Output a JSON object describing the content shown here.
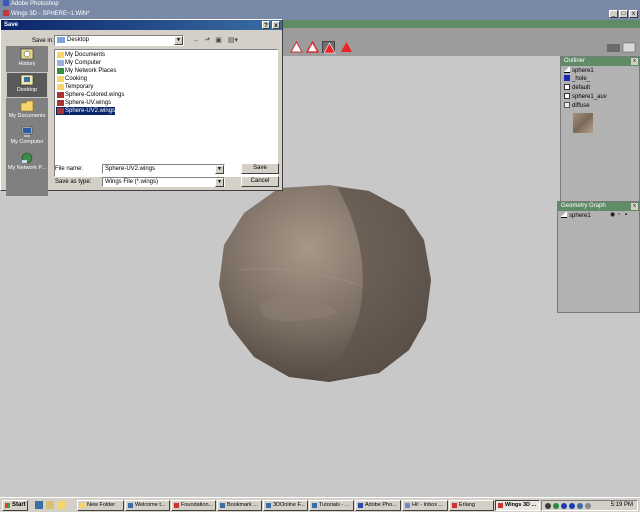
{
  "photoshop_title": "Adobe Photoshop",
  "wings_title": "Wings 3D - SPHERE~1.WIN*",
  "window_buttons": [
    "_",
    "□",
    "x"
  ],
  "dialog": {
    "title": "Save",
    "help": "?",
    "close": "x",
    "save_in_label": "Save in:",
    "save_in_value": "Desktop",
    "places": [
      {
        "label": "History",
        "icon": "history-icon"
      },
      {
        "label": "Desktop",
        "icon": "desktop-icon"
      },
      {
        "label": "My Documents",
        "icon": "my-documents-icon"
      },
      {
        "label": "My Computer",
        "icon": "my-computer-icon"
      },
      {
        "label": "My Network P...",
        "icon": "network-places-icon"
      }
    ],
    "files": [
      {
        "name": "My Documents",
        "icon": "folder-icon"
      },
      {
        "name": "My Computer",
        "icon": "computer-icon"
      },
      {
        "name": "My Network Places",
        "icon": "network-icon"
      },
      {
        "name": "Cooking",
        "icon": "folder-icon"
      },
      {
        "name": "Temporary",
        "icon": "folder-icon"
      },
      {
        "name": "Sphere-Colored.wings",
        "icon": "wings-file-icon"
      },
      {
        "name": "Sphere-UV.wings",
        "icon": "wings-file-icon"
      },
      {
        "name": "Sphere-UV2.wings",
        "icon": "wings-file-icon"
      }
    ],
    "selected_file": "Sphere-UV2.wings",
    "file_name_label": "File name:",
    "file_name_value": "Sphere-UV2.wings",
    "save_as_type_label": "Save as type:",
    "save_as_type_value": "Wings File (*.wings)",
    "save_button": "Save",
    "cancel_button": "Cancel"
  },
  "outliner": {
    "title": "Outliner",
    "close": "x",
    "items": [
      {
        "label": "sphere1",
        "icon": "object-icon"
      },
      {
        "label": "_hole_",
        "icon": "material-blue-icon"
      },
      {
        "label": "default",
        "icon": "material-icon"
      },
      {
        "label": "sphere1_auv",
        "icon": "material-icon"
      },
      {
        "label": "diffuse",
        "icon": "image-icon"
      }
    ]
  },
  "geometry_graph": {
    "title": "Geometry Graph",
    "close": "x",
    "items": [
      {
        "label": "sphere1",
        "icon": "object-icon"
      }
    ]
  },
  "taskbar": {
    "start": "Start",
    "tasks": [
      {
        "label": "New Folder"
      },
      {
        "label": "Welcome t..."
      },
      {
        "label": "Foundation..."
      },
      {
        "label": "Bookmark ..."
      },
      {
        "label": "3DOnline F..."
      },
      {
        "label": "Tutorials - ..."
      },
      {
        "label": "Adobe Pho..."
      },
      {
        "label": "Hi! - Inbox ..."
      },
      {
        "label": "Erlang"
      },
      {
        "label": "Wings 3D ..."
      }
    ],
    "clock": "5:19 PM"
  },
  "colors": {
    "titlebar": "#7a8aa6",
    "wings_green": "#5f8b67",
    "dialog_title": "#0a246a",
    "selection": "#0a246a",
    "sphere": "#6e6258"
  }
}
